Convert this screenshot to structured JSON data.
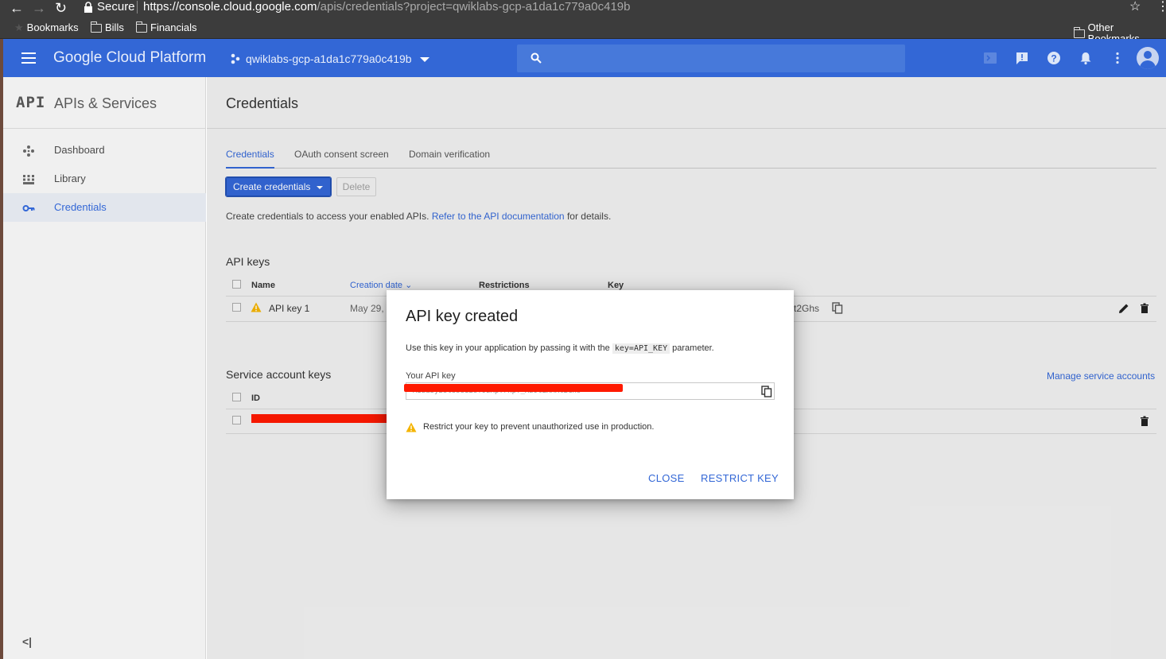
{
  "browser": {
    "secure_label": "Secure",
    "url_host": "https://console.cloud.google.com",
    "url_path": "/apis/credentials?project=qwiklabs-gcp-a1da1c779a0c419b",
    "bookmarks": [
      "Bookmarks",
      "Bills",
      "Financials"
    ],
    "other_bookmarks": "Other Bookmarks"
  },
  "header": {
    "title": "Google Cloud Platform",
    "project": "qwiklabs-gcp-a1da1c779a0c419b",
    "accent_color": "#3367d6"
  },
  "sidebar": {
    "logo": "API",
    "title": "APIs & Services",
    "items": [
      {
        "label": "Dashboard",
        "icon": "dashboard-icon"
      },
      {
        "label": "Library",
        "icon": "library-icon"
      },
      {
        "label": "Credentials",
        "icon": "key-icon",
        "active": true
      }
    ],
    "collapse_label": "<|"
  },
  "page": {
    "title": "Credentials",
    "tabs": [
      "Credentials",
      "OAuth consent screen",
      "Domain verification"
    ],
    "create_button": "Create credentials",
    "delete_button": "Delete",
    "intro_text": "Create credentials to access your enabled APIs.",
    "intro_link": "Refer to the API documentation",
    "intro_suffix": " for details.",
    "api_keys": {
      "title": "API keys",
      "columns": [
        "Name",
        "Creation date",
        "Restrictions",
        "Key"
      ],
      "rows": [
        {
          "name": "API key 1",
          "date": "May 29,",
          "key_tail": "t2Ghs"
        }
      ]
    },
    "service_keys": {
      "title": "Service account keys",
      "columns": [
        "ID"
      ],
      "manage_link": "Manage service accounts"
    }
  },
  "dialog": {
    "title": "API key created",
    "text_before": "Use this key in your application by passing it with the ",
    "code": "key=API_KEY",
    "text_after": " parameter.",
    "field_label": "Your API key",
    "key_value": "AIzaSyB8t8s8i28T9zXpTrnpT_Xz9tLXMRt2Ghs",
    "warning": "Restrict your key to prevent unauthorized use in production.",
    "close_button": "CLOSE",
    "restrict_button": "RESTRICT KEY"
  }
}
